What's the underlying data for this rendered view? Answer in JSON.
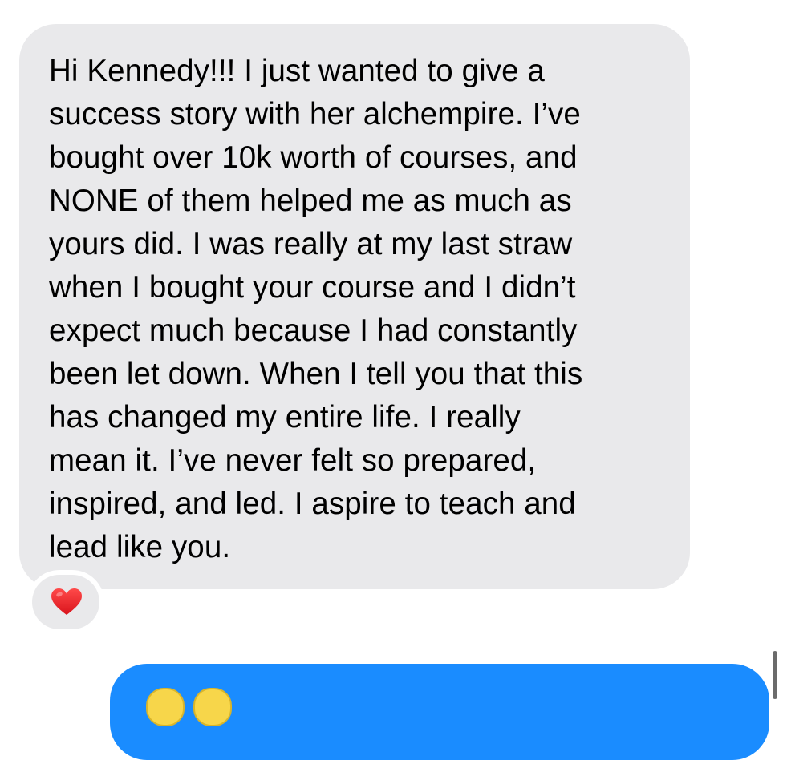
{
  "incoming_message": {
    "text": "Hi Kennedy!!! I just wanted to give a\nsuccess story with her alchempire. I’ve\nbought over 10k worth of courses, and\nNONE of them helped me as much as\nyours did. I was really at my last straw\nwhen I bought your course and I didn’t\nexpect much because I had constantly\nbeen let down. When I tell you that this\nhas changed my entire life. I really\nmean it. I’ve never felt so prepared,\ninspired, and led. I aspire to teach and\nlead like you.",
    "reaction": {
      "icon": "heart-icon",
      "color": "#e8202a"
    }
  },
  "colors": {
    "incoming_bubble": "#e9e9eb",
    "outgoing_bubble": "#1a8cff",
    "background": "#ffffff"
  }
}
